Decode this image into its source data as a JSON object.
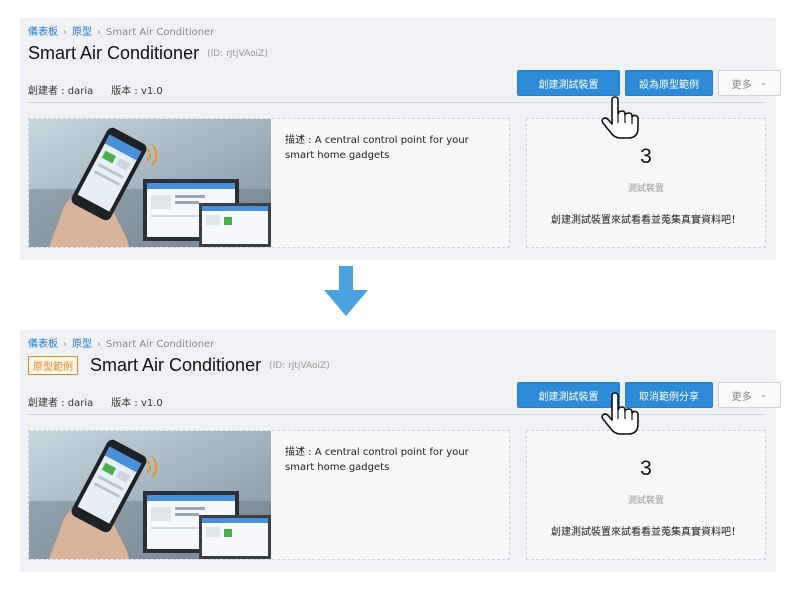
{
  "breadcrumb": {
    "dashboard": "儀表板",
    "prototypes": "原型",
    "current": "Smart Air Conditioner",
    "separator": "›"
  },
  "product": {
    "title": "Smart Air Conditioner",
    "id": "(ID: rJtjVAoiZ)",
    "creator": "創建者 : daria",
    "version": "版本 : v1.0",
    "description": "描述 : A central control point for your smart home gadgets"
  },
  "stats": {
    "count": "3",
    "count_label": "測試裝置",
    "hint": "創建測試裝置來試看看並蒐集真實資料吧！"
  },
  "before": {
    "buttons": {
      "create_device": "創建測試裝置",
      "set_example": "設為原型範例",
      "more": "更多"
    }
  },
  "after": {
    "badge": "原型範例",
    "buttons": {
      "create_device": "創建測試裝置",
      "cancel_example": "取消範例分享",
      "more": "更多"
    }
  },
  "colors": {
    "primary": "#2c8ad8",
    "badge": "#e8891c",
    "arrow": "#4aa3e0",
    "link": "#1f78c8"
  },
  "icons": {
    "cursor": "hand-pointer-icon",
    "arrow": "arrow-down-icon",
    "caret": "chevron-down-icon"
  }
}
